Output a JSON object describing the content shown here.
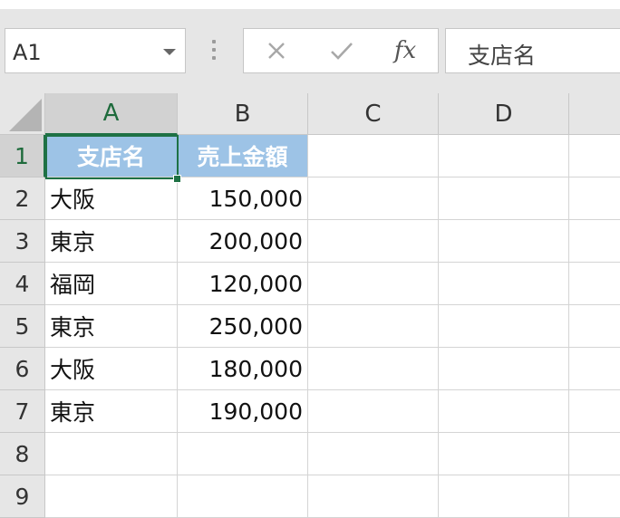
{
  "name_box": {
    "value": "A1"
  },
  "formula_bar": {
    "content": "支店名",
    "fx_label": "fx"
  },
  "columns": [
    "A",
    "B",
    "C",
    "D"
  ],
  "rows": [
    "1",
    "2",
    "3",
    "4",
    "5",
    "6",
    "7",
    "8",
    "9"
  ],
  "cells": {
    "A1": "支店名",
    "B1": "売上金額",
    "A2": "大阪",
    "B2": "150,000",
    "A3": "東京",
    "B3": "200,000",
    "A4": "福岡",
    "B4": "120,000",
    "A5": "東京",
    "B5": "250,000",
    "A6": "大阪",
    "B6": "180,000",
    "A7": "東京",
    "B7": "190,000"
  },
  "colors": {
    "header_fill": "#9dc3e6",
    "selection": "#1e7145"
  }
}
